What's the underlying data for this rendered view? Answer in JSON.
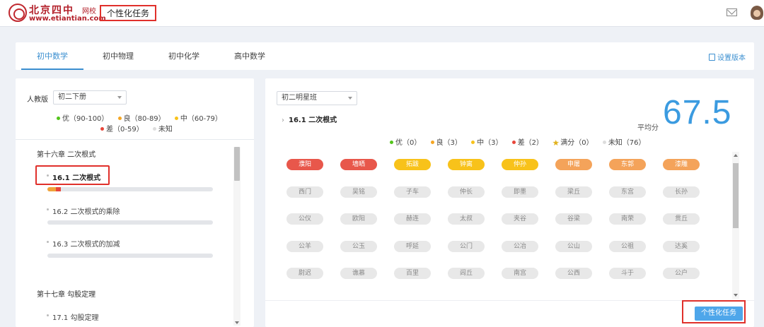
{
  "header": {
    "brand_cn": "北京四中",
    "brand_sub": "网校",
    "brand_url": "www.etiantian.com",
    "page_title": "个性化任务",
    "icons": [
      "mail-icon",
      "avatar"
    ]
  },
  "tabs": [
    {
      "label": "初中数学",
      "active": true
    },
    {
      "label": "初中物理",
      "active": false
    },
    {
      "label": "初中化学",
      "active": false
    },
    {
      "label": "高中数学",
      "active": false
    }
  ],
  "settings_label": "设置版本",
  "left": {
    "edition_label": "人教版",
    "volume_select": "初二下册",
    "legend": [
      {
        "label": "优（90-100）",
        "color": "#52c41a"
      },
      {
        "label": "良（80-89）",
        "color": "#f5a623"
      },
      {
        "label": "中（60-79）",
        "color": "#f8c21a"
      },
      {
        "label": "差（0-59）",
        "color": "#e8463a"
      },
      {
        "label": "未知",
        "color": "#dddddd"
      }
    ],
    "chapters": [
      {
        "title": "第十六章 二次根式",
        "sections": [
          {
            "label": "16.1 二次根式",
            "active": true,
            "progress": [
              {
                "color": "#f0a33a",
                "fraction": 0.05
              },
              {
                "color": "#e8463a",
                "fraction": 0.03
              }
            ]
          },
          {
            "label": "16.2 二次根式的乘除",
            "active": false,
            "progress": []
          },
          {
            "label": "16.3 二次根式的加减",
            "active": false,
            "progress": []
          }
        ]
      },
      {
        "title": "第十七章 勾股定理",
        "sections": [
          {
            "label": "17.1 勾股定理",
            "active": false,
            "progress": []
          }
        ]
      }
    ]
  },
  "right": {
    "class_select": "初二明星班",
    "current_section": "16.1 二次根式",
    "avg_label": "平均分",
    "avg_value": "67.5",
    "stats": [
      {
        "label": "优（0）",
        "color": "#52c41a"
      },
      {
        "label": "良（3）",
        "color": "#f5a623"
      },
      {
        "label": "中（3）",
        "color": "#f8c21a"
      },
      {
        "label": "差（2）",
        "color": "#e8463a"
      },
      {
        "label": "满分（0）",
        "icon": "star-icon"
      },
      {
        "label": "未知（76）",
        "color": "#dddddd"
      }
    ],
    "students": [
      {
        "name": "濮阳",
        "level": "poor"
      },
      {
        "name": "墙晒",
        "level": "poor"
      },
      {
        "name": "拓跋",
        "level": "fair"
      },
      {
        "name": "钟离",
        "level": "fair"
      },
      {
        "name": "仲孙",
        "level": "fair"
      },
      {
        "name": "申屠",
        "level": "good"
      },
      {
        "name": "东郭",
        "level": "good"
      },
      {
        "name": "漆雕",
        "level": "good"
      },
      {
        "name": "西门",
        "level": "unknown"
      },
      {
        "name": "吴铭",
        "level": "unknown"
      },
      {
        "name": "子车",
        "level": "unknown"
      },
      {
        "name": "仲长",
        "level": "unknown"
      },
      {
        "name": "即墨",
        "level": "unknown"
      },
      {
        "name": "梁丘",
        "level": "unknown"
      },
      {
        "name": "东宫",
        "level": "unknown"
      },
      {
        "name": "长孙",
        "level": "unknown"
      },
      {
        "name": "公仪",
        "level": "unknown"
      },
      {
        "name": "欧阳",
        "level": "unknown"
      },
      {
        "name": "赫连",
        "level": "unknown"
      },
      {
        "name": "太叔",
        "level": "unknown"
      },
      {
        "name": "夹谷",
        "level": "unknown"
      },
      {
        "name": "谷梁",
        "level": "unknown"
      },
      {
        "name": "南荣",
        "level": "unknown"
      },
      {
        "name": "贯丘",
        "level": "unknown"
      },
      {
        "name": "公羊",
        "level": "unknown"
      },
      {
        "name": "公玉",
        "level": "unknown"
      },
      {
        "name": "呼延",
        "level": "unknown"
      },
      {
        "name": "公门",
        "level": "unknown"
      },
      {
        "name": "公冶",
        "level": "unknown"
      },
      {
        "name": "公山",
        "level": "unknown"
      },
      {
        "name": "公祖",
        "level": "unknown"
      },
      {
        "name": "达奚",
        "level": "unknown"
      },
      {
        "name": "尉迟",
        "level": "unknown"
      },
      {
        "name": "谯慕",
        "level": "unknown"
      },
      {
        "name": "百里",
        "level": "unknown"
      },
      {
        "name": "闾丘",
        "level": "unknown"
      },
      {
        "name": "南宫",
        "level": "unknown"
      },
      {
        "name": "公西",
        "level": "unknown"
      },
      {
        "name": "斗于",
        "level": "unknown"
      },
      {
        "name": "公户",
        "level": "unknown"
      }
    ],
    "level_colors": {
      "poor": "#e8574b",
      "fair": "#f8c21a",
      "good": "#f4a35a",
      "unknown": "#e8e8e8"
    },
    "task_button": "个性化任务"
  }
}
